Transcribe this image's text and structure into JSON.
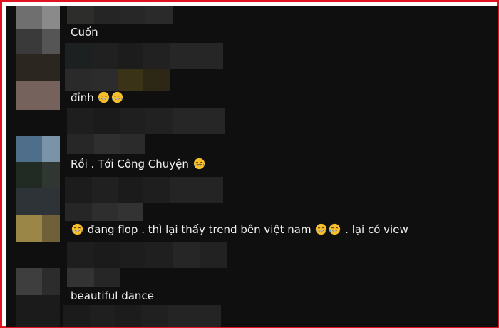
{
  "comments": [
    {
      "text": "Cuốn",
      "emoji_count": 0
    },
    {
      "text": "đỉnh",
      "emoji_count": 2
    },
    {
      "text": "Rồi . Tới Công Chuyện",
      "emoji_count": 1
    },
    {
      "text_parts": [
        "đang flop . thì lại thấy trend bên việt nam",
        ". lại có view"
      ],
      "leading_emoji": 1,
      "middle_emoji": 2
    },
    {
      "text": "beautiful dance",
      "emoji_count": 0
    }
  ],
  "emoji_name": "face-with-tears-of-joy-icon",
  "colors": {
    "frame_border": "#e0141e",
    "background": "#0f0f0f",
    "text": "#f1f1f1"
  }
}
